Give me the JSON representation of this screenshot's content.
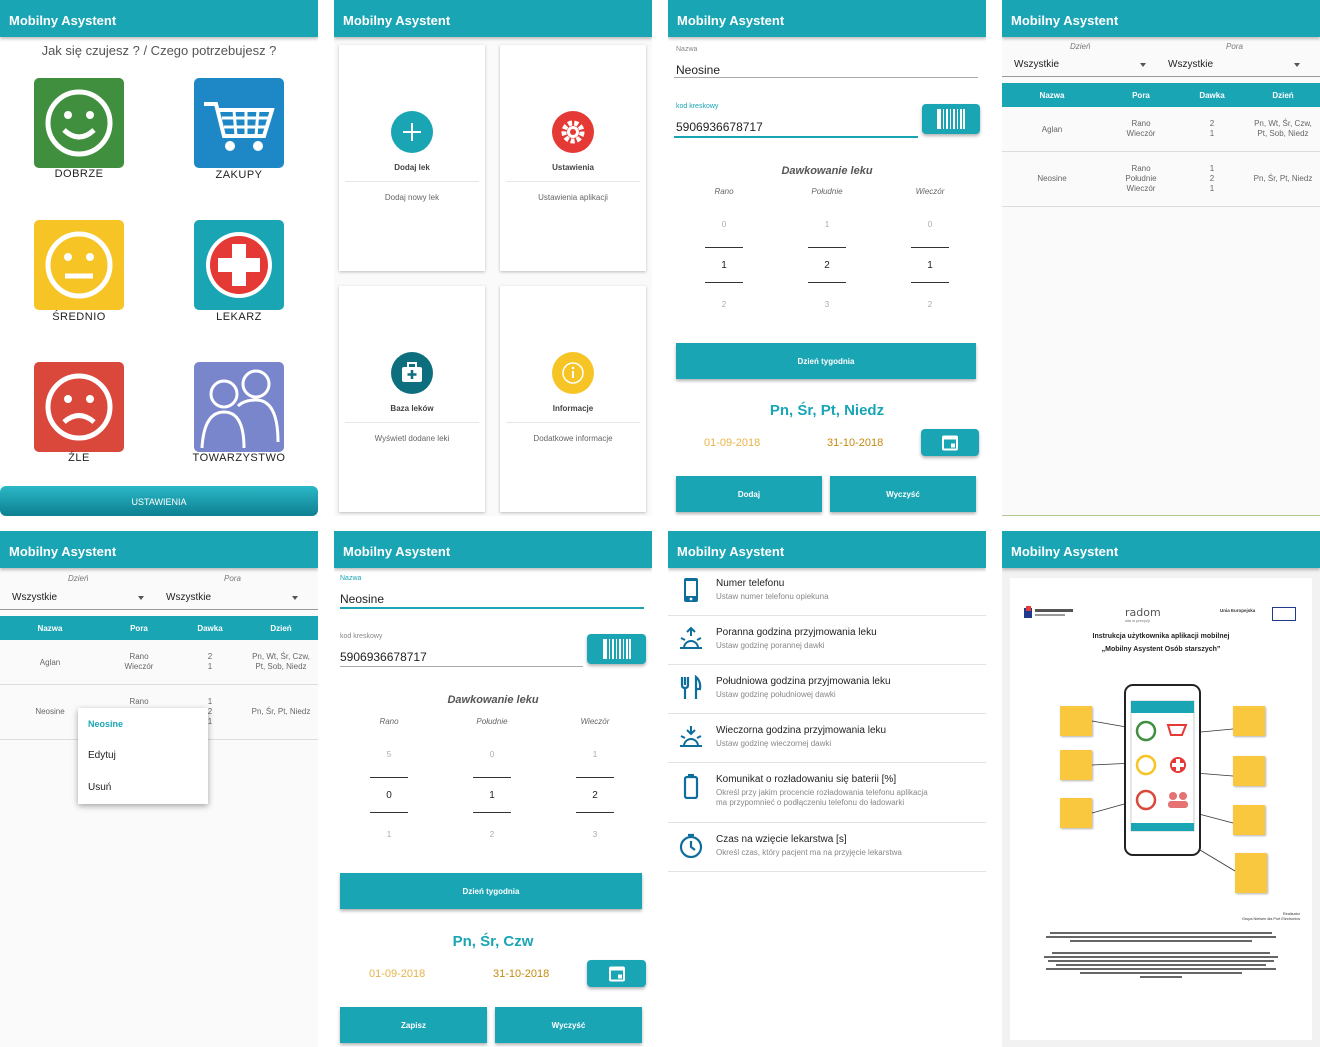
{
  "app_title": "Mobilny Asystent",
  "home": {
    "question": "Jak się czujesz ? / Czego potrzebujesz ?",
    "tiles": [
      {
        "label": "DOBRZE",
        "color": "#3f8f3f"
      },
      {
        "label": "ZAKUPY",
        "color": "#1e88c7"
      },
      {
        "label": "ŚREDNIO",
        "color": "#f6c425"
      },
      {
        "label": "LEKARZ",
        "color": "#1aa5b5"
      },
      {
        "label": "ŹLE",
        "color": "#d9483b"
      },
      {
        "label": "TOWARZYSTWO",
        "color": "#7986cb"
      }
    ],
    "settings_button": "USTAWIENIA"
  },
  "menu": {
    "cards": [
      {
        "title": "Dodaj lek",
        "desc": "Dodaj nowy lek",
        "icon": "plus-icon",
        "color": "#1aa5b5"
      },
      {
        "title": "Ustawienia",
        "desc": "Ustawienia aplikacji",
        "icon": "gear-icon",
        "color": "#e53935"
      },
      {
        "title": "Baza leków",
        "desc": "Wyświetl dodane leki",
        "icon": "medkit-icon",
        "color": "#0d6e7e"
      },
      {
        "title": "Informacje",
        "desc": "Dodatkowe informacje",
        "icon": "info-icon",
        "color": "#f6c425"
      }
    ]
  },
  "add_form": {
    "name_label": "Nazwa",
    "name_value": "Neosine",
    "barcode_label": "kod kreskowy",
    "barcode_value": "5906936678717",
    "dosage_title": "Dawkowanie leku",
    "cols": [
      "Rano",
      "Południe",
      "Wieczór"
    ],
    "picker": {
      "prev": [
        "0",
        "1",
        "0"
      ],
      "cur": [
        "1",
        "2",
        "1"
      ],
      "next": [
        "2",
        "3",
        "2"
      ]
    },
    "weekday_button": "Dzień tygodnia",
    "days": "Pn, Śr, Pt, Niedz",
    "date_from": "01-09-2018",
    "date_to": "31-10-2018",
    "add_button": "Dodaj",
    "clear_button": "Wyczyść"
  },
  "list": {
    "filter_day_label": "Dzień",
    "filter_time_label": "Pora",
    "filter_day_value": "Wszystkie",
    "filter_time_value": "Wszystkie",
    "headers": [
      "Nazwa",
      "Pora",
      "Dawka",
      "Dzień"
    ],
    "rows": [
      {
        "name": "Aglan",
        "pora": "Rano\nWieczór",
        "dawka": "2\n1",
        "dzien": "Pn, Wt, Śr, Czw,\nPt, Sob, Niedz"
      },
      {
        "name": "Neosine",
        "pora": "Rano\nPołudnie\nWieczór",
        "dawka": "1\n2\n1",
        "dzien": "Pn, Śr, Pt, Niedz"
      }
    ]
  },
  "popup": {
    "title": "Neosine",
    "edit": "Edytuj",
    "delete": "Usuń"
  },
  "edit_form": {
    "name_value": "Neosine",
    "barcode_value": "5906936678717",
    "picker": {
      "prev": [
        "5",
        "0",
        "1"
      ],
      "cur": [
        "0",
        "1",
        "2"
      ],
      "next": [
        "1",
        "2",
        "3"
      ]
    },
    "days": "Pn, Śr, Czw",
    "date_from": "01-09-2018",
    "date_to": "31-10-2018",
    "save_button": "Zapisz",
    "clear_button": "Wyczyść",
    "weekday_button": "Dzień tygodnia"
  },
  "settings": {
    "items": [
      {
        "title": "Numer telefonu",
        "sub": "Ustaw numer telefonu opiekuna",
        "icon": "phone-icon"
      },
      {
        "title": "Poranna godzina przyjmowania leku",
        "sub": "Ustaw godzinę porannej dawki",
        "icon": "sunrise-icon"
      },
      {
        "title": "Południowa godzina przyjmowania leku",
        "sub": "Ustaw godzinę południowej dawki",
        "icon": "cutlery-icon"
      },
      {
        "title": "Wieczorna godzina przyjmowania leku",
        "sub": "Ustaw godzinę wieczornej dawki",
        "icon": "sunset-icon"
      },
      {
        "title": "Komunikat o rozładowaniu się baterii [%]",
        "sub": "Określ przy jakim procencie rozładowania telefonu aplikacja\nma przypomnieć o podłączeniu telefonu do ładowarki",
        "icon": "battery-icon"
      },
      {
        "title": "Czas na wzięcie lekarstwa [s]",
        "sub": "Określ czas, który pacjent ma na przyjęcie lekarstwa",
        "icon": "timer-icon"
      }
    ]
  },
  "doc": {
    "title_line1": "Instrukcja użytkownika aplikacji mobilnej",
    "title_line2": "„Mobilny Asystent Osób starszych”",
    "logo_mid": "radom",
    "logo_mid_sub": "siła w precyzji",
    "logo_right": "Unia Europejska",
    "phone_button": "USTAWIENIA",
    "realizator": "Realizator\nGrupa Nielsen dla Port Electronics"
  }
}
